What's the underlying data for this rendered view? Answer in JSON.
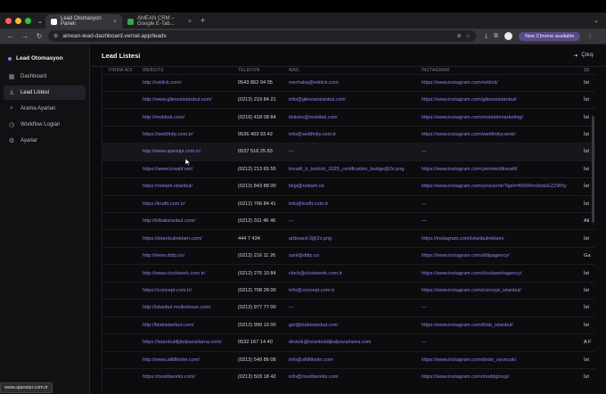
{
  "browser": {
    "tabs": [
      {
        "label": "Lead Otomasyon Paneli",
        "active": true,
        "favicon_color": "#ffffff"
      },
      {
        "label": "AMEAN CRM – Google E-Tab...",
        "active": false,
        "favicon_color": "#34a853"
      }
    ],
    "url": "amean-lead-dashboard.vercel.app/leads",
    "chrome_button": "New Chrome available"
  },
  "sidebar": {
    "brand": "Lead Otomasyon",
    "items": [
      {
        "label": "Dashboard",
        "icon": "grid-icon",
        "active": false
      },
      {
        "label": "Lead Listesi",
        "icon": "users-icon",
        "active": true
      },
      {
        "label": "Arama Ayarları",
        "icon": "search-icon",
        "active": false
      },
      {
        "label": "Workflow Logları",
        "icon": "clock-icon",
        "active": false
      },
      {
        "label": "Ayarlar",
        "icon": "gear-icon",
        "active": false
      }
    ]
  },
  "header": {
    "title": "Lead Listesi",
    "logout": "Çıkış"
  },
  "table": {
    "columns": [
      "FIRMA ADI",
      "WEBSITE",
      "TELEFON",
      "MAIL",
      "INSTAGRAM",
      "ŞE"
    ],
    "rows": [
      {
        "firma": "",
        "website": "http://reklick.com/",
        "phone": "0543 862 94 05",
        "mail": "merhaba@reklick.com",
        "instagram": "https://www.instagram.com/reklick/",
        "city": "İst"
      },
      {
        "firma": "",
        "website": "http://www.gliesseistanbul.com/",
        "phone": "(0212) 219 84 21",
        "mail": "info@gliesseistanbul.com",
        "instagram": "https://www.instagram.com/gliesseistanbul/",
        "city": "İst"
      },
      {
        "firma": "",
        "website": "http://mobitek.com/",
        "phone": "(0216) 418 08 84",
        "mail": "iletisim@mobitek.com",
        "instagram": "https://www.instagram.com/mobitekmarketing/",
        "city": "İst"
      },
      {
        "firma": "",
        "website": "https://webfinity.com.tr/",
        "phone": "0536 403 93 42",
        "mail": "info@webfinity.com.tr",
        "instagram": "https://www.instagram.com/webfinitycomtr/",
        "city": "İst"
      },
      {
        "firma": "",
        "website": "http://www.ajansipi.com.tr/",
        "phone": "0537 516 25 83",
        "mail": "—",
        "instagram": "—",
        "city": "İst"
      },
      {
        "firma": "",
        "website": "https://www.kreatif.net/",
        "phone": "(0212) 213 65 55",
        "mail": "kreatif_tr_turkish_2025_certification_badge@2x.png",
        "instagram": "https://www.instagram.com/yenimedikreatif/",
        "city": "İst"
      },
      {
        "firma": "",
        "website": "https://reklam.istanbul/",
        "phone": "(0212) 843 88 00",
        "mail": "bilgi@reklam.ist",
        "instagram": "https://www.instagram.com/yovisomtr?igsh=MXRhm9sdzEZZWhy",
        "city": "İst"
      },
      {
        "firma": "",
        "website": "https://kraftt.com.tr/",
        "phone": "(0212) 706 84 41",
        "mail": "info@kraftt.com.tr",
        "instagram": "—",
        "city": "İst"
      },
      {
        "firma": "",
        "website": "http://tribalistanbul.com/",
        "phone": "(0212) 311 46 46",
        "mail": "—",
        "instagram": "—",
        "city": "Ali"
      },
      {
        "firma": "",
        "website": "https://istanbulreklam.com/",
        "phone": "444 7 434",
        "mail": "artboard-3@2x.png",
        "instagram": "https://instagram.com/istanbulreklam/",
        "city": "İst"
      },
      {
        "firma": "",
        "website": "http://www.ddip.co/",
        "phone": "(0212) 216 11 26",
        "mail": "sanl@ddip.co",
        "instagram": "https://www.instagram.com/ddipagency/",
        "city": "Ga"
      },
      {
        "firma": "",
        "website": "http://www.clockwork.com.tr/",
        "phone": "(0212) 275 10 84",
        "mail": "clock@clockwork.com.tr",
        "instagram": "https://www.instagram.com/clockworkagency/",
        "city": "İst"
      },
      {
        "firma": "",
        "website": "https://concept.com.tr/",
        "phone": "(0212) 708 28 00",
        "mail": "info@concept.com.tr",
        "instagram": "https://www.instagram.com/concept_istanbul/",
        "city": "İst"
      },
      {
        "firma": "",
        "website": "http://istanbul.mullenlowe.com/",
        "phone": "(0212) 977 77 00",
        "mail": "—",
        "instagram": "—",
        "city": "İst"
      },
      {
        "firma": "",
        "website": "http://blabistanbul.com/",
        "phone": "(0212) 999 10 00",
        "mail": "gel@blabistanbul.com",
        "instagram": "https://www.instagram.com/blab_istanbul/",
        "city": "İst"
      },
      {
        "firma": "",
        "website": "https://istanbuldijitalpazarlama.com/",
        "phone": "0532 167 14 40",
        "mail": "destek@istanbuldijitalpazarlama.com",
        "instagram": "—",
        "city": "A F"
      },
      {
        "firma": "",
        "website": "http://www.afilifikirler.com/",
        "phone": "(0212) 549 86 08",
        "mail": "info@afilifikirler.com",
        "instagram": "https://www.instagram.com/dede_oyuncak/",
        "city": "İst"
      },
      {
        "firma": "",
        "website": "https://moddworks.com/",
        "phone": "(0212) 503 18 42",
        "mail": "info@moddworks.com",
        "instagram": "https://www.instagram.com/moddgroup/",
        "city": "İst"
      }
    ]
  },
  "hover_row": 4,
  "status_url": "www.ajansipi.com.tr"
}
